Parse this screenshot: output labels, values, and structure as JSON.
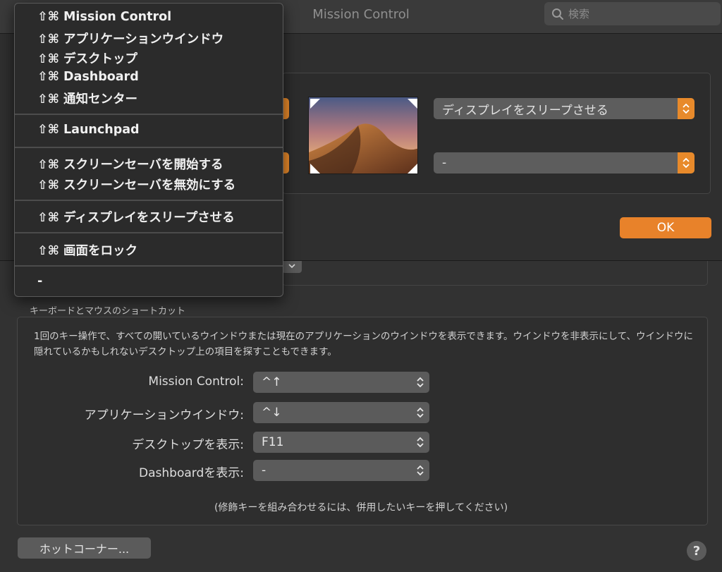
{
  "window": {
    "title": "Mission Control",
    "search_placeholder": "検索"
  },
  "sheet": {
    "top_right_popup": "ディスプレイをスリープさせる",
    "bottom_right_popup": "-",
    "ok_label": "OK"
  },
  "menu": {
    "items": [
      "⇧⌘ Mission Control",
      "⇧⌘ アプリケーションウインドウ",
      "⇧⌘ デスクトップ",
      "⇧⌘ Dashboard",
      "⇧⌘ 通知センター",
      "⇧⌘ Launchpad",
      "⇧⌘ スクリーンセーバを開始する",
      "⇧⌘ スクリーンセーバを無効にする",
      "⇧⌘ ディスプレイをスリープさせる",
      "⇧⌘ 画面をロック",
      "-"
    ]
  },
  "shortcuts": {
    "section_title": "キーボードとマウスのショートカット",
    "description": "1回のキー操作で、すべての開いているウインドウまたは現在のアプリケーションのウインドウを表示できます。ウインドウを非表示にして、ウインドウに隠れているかもしれないデスクトップ上の項目を探すこともできます。",
    "rows": [
      {
        "label": "Mission Control:",
        "value": "^↑"
      },
      {
        "label": "アプリケーションウインドウ:",
        "value": "^↓"
      },
      {
        "label": "デスクトップを表示:",
        "value": "F11"
      },
      {
        "label": "Dashboardを表示:",
        "value": "-"
      }
    ],
    "hint": "(修飾キーを組み合わせるには、併用したいキーを押してください)"
  },
  "footer": {
    "hot_corners_label": "ホットコーナー...",
    "help_label": "?"
  },
  "colors": {
    "accent": "#e8822a",
    "background": "#323232"
  }
}
